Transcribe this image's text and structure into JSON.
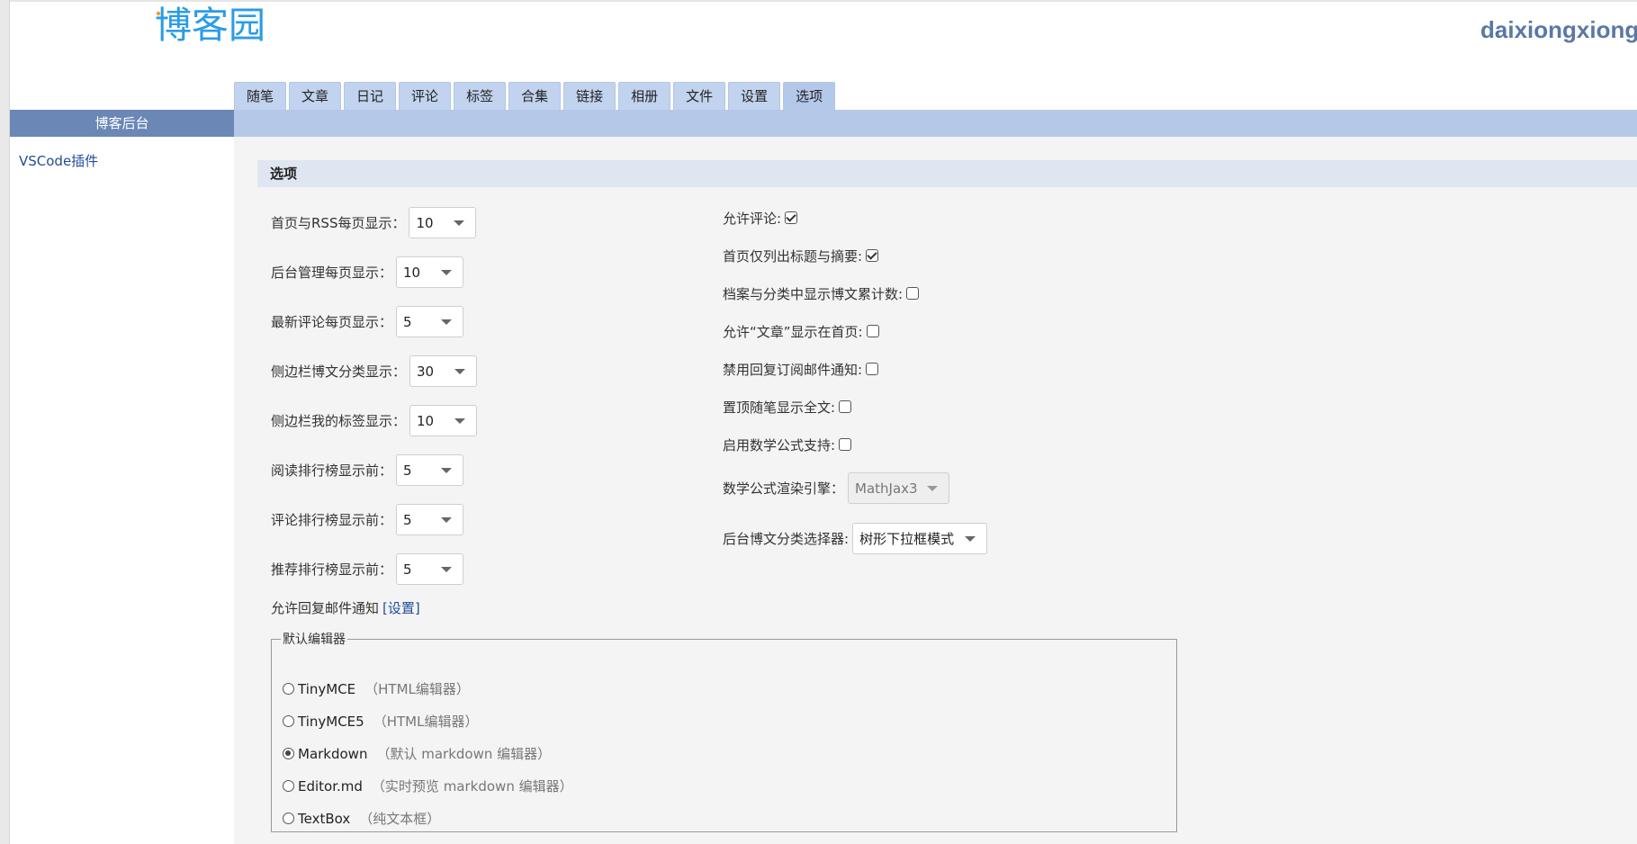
{
  "header": {
    "logo_text": "博客园",
    "username": "daixiongxiong"
  },
  "tabs": [
    {
      "label": "随笔"
    },
    {
      "label": "文章"
    },
    {
      "label": "日记"
    },
    {
      "label": "评论"
    },
    {
      "label": "标签"
    },
    {
      "label": "合集"
    },
    {
      "label": "链接"
    },
    {
      "label": "相册"
    },
    {
      "label": "文件"
    },
    {
      "label": "设置"
    },
    {
      "label": "选项",
      "active": true
    }
  ],
  "sidebar": {
    "header": "博客后台",
    "items": [
      {
        "label": "VSCode插件"
      }
    ]
  },
  "section": {
    "title": "选项"
  },
  "left_options": [
    {
      "label": "首页与RSS每页显示：",
      "value": "10"
    },
    {
      "label": "后台管理每页显示：",
      "value": "10"
    },
    {
      "label": "最新评论每页显示：",
      "value": "5"
    },
    {
      "label": "侧边栏博文分类显示：",
      "value": "30"
    },
    {
      "label": "侧边栏我的标签显示：",
      "value": "10"
    },
    {
      "label": "阅读排行榜显示前：",
      "value": "5"
    },
    {
      "label": "评论排行榜显示前：",
      "value": "5"
    },
    {
      "label": "推荐排行榜显示前：",
      "value": "5"
    }
  ],
  "reply_notice": {
    "label": "允许回复邮件通知",
    "link": "[设置]"
  },
  "right_options": {
    "checkboxes": [
      {
        "label": "允许评论:",
        "checked": true
      },
      {
        "label": "首页仅列出标题与摘要:",
        "checked": true
      },
      {
        "label": "档案与分类中显示博文累计数:",
        "checked": false
      },
      {
        "label": "允许“文章”显示在首页:",
        "checked": false
      },
      {
        "label": "禁用回复订阅邮件通知:",
        "checked": false
      },
      {
        "label": "置顶随笔显示全文:",
        "checked": false
      },
      {
        "label": "启用数学公式支持:",
        "checked": false
      }
    ],
    "math_engine": {
      "label": "数学公式渲染引擎：",
      "value": "MathJax3",
      "disabled": true
    },
    "category_selector": {
      "label": "后台博文分类选择器:",
      "value": "树形下拉框模式"
    }
  },
  "editor": {
    "legend": "默认编辑器",
    "options": [
      {
        "name": "TinyMCE",
        "desc": "（HTML编辑器）",
        "checked": false
      },
      {
        "name": "TinyMCE5",
        "desc": "（HTML编辑器）",
        "checked": false
      },
      {
        "name": "Markdown",
        "desc": "（默认 markdown 编辑器）",
        "checked": true
      },
      {
        "name": "Editor.md",
        "desc": "（实时预览 markdown 编辑器）",
        "checked": false
      },
      {
        "name": "TextBox",
        "desc": "（纯文本框）",
        "checked": false
      }
    ]
  },
  "colors": {
    "brand_blue": "#2a9ce8",
    "header_bar": "#6a87b6",
    "tab_bg": "#c1d3ee",
    "link": "#1f4d9a"
  }
}
